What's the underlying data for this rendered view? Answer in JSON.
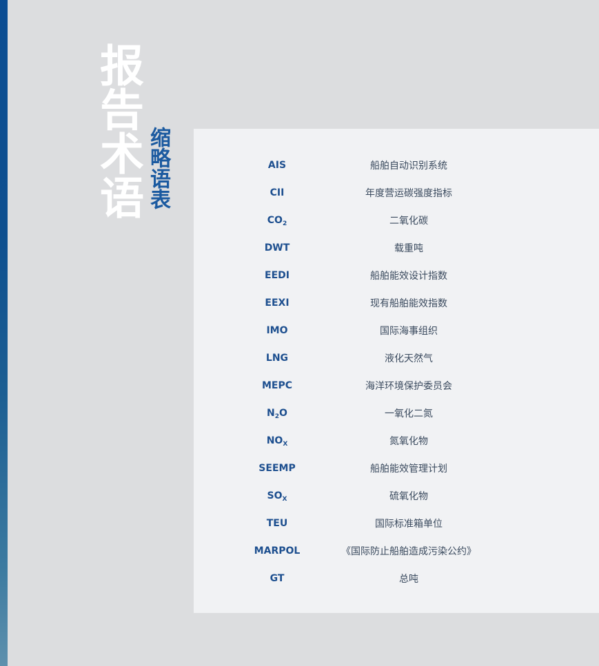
{
  "title": {
    "main": "报告术语",
    "sub": "缩略语表"
  },
  "glossary": [
    {
      "abbr": "AIS",
      "sub": "",
      "tail": "",
      "term": "船舶自动识别系统"
    },
    {
      "abbr": "CII",
      "sub": "",
      "tail": "",
      "term": "年度营运碳强度指标"
    },
    {
      "abbr": "CO",
      "sub": "2",
      "tail": "",
      "term": "二氧化碳"
    },
    {
      "abbr": "DWT",
      "sub": "",
      "tail": "",
      "term": "载重吨"
    },
    {
      "abbr": "EEDI",
      "sub": "",
      "tail": "",
      "term": "船舶能效设计指数"
    },
    {
      "abbr": "EEXI",
      "sub": "",
      "tail": "",
      "term": "现有船舶能效指数"
    },
    {
      "abbr": "IMO",
      "sub": "",
      "tail": "",
      "term": "国际海事组织"
    },
    {
      "abbr": "LNG",
      "sub": "",
      "tail": "",
      "term": "液化天然气"
    },
    {
      "abbr": "MEPC",
      "sub": "",
      "tail": "",
      "term": "海洋环境保护委员会"
    },
    {
      "abbr": "N",
      "sub": "2",
      "tail": "O",
      "term": "一氧化二氮"
    },
    {
      "abbr": "NO",
      "sub": "X",
      "tail": "",
      "term": "氮氧化物"
    },
    {
      "abbr": "SEEMP",
      "sub": "",
      "tail": "",
      "term": "船舶能效管理计划"
    },
    {
      "abbr": "SO",
      "sub": "X",
      "tail": "",
      "term": "硫氧化物"
    },
    {
      "abbr": "TEU",
      "sub": "",
      "tail": "",
      "term": "国际标准箱单位"
    },
    {
      "abbr": "MARPOL",
      "sub": "",
      "tail": "",
      "term": "《国际防止船舶造成污染公约》"
    },
    {
      "abbr": "GT",
      "sub": "",
      "tail": "",
      "term": "总吨"
    }
  ]
}
